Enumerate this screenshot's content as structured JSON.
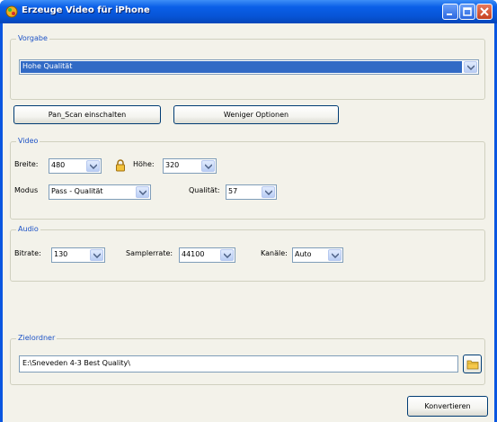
{
  "window": {
    "title": "Erzeuge Video für iPhone"
  },
  "vorgabe": {
    "legend": "Vorgabe",
    "selected": "Hohe Qualität"
  },
  "buttons": {
    "pan_scan": "Pan_Scan einschalten",
    "fewer_options": "Weniger Optionen",
    "convert": "Konvertieren"
  },
  "video": {
    "legend": "Video",
    "width_label": "Breite:",
    "width_value": "480",
    "height_label": "Höhe:",
    "height_value": "320",
    "mode_label": "Modus",
    "mode_value": "Pass - Qualität",
    "quality_label": "Qualität:",
    "quality_value": "57"
  },
  "audio": {
    "legend": "Audio",
    "bitrate_label": "Bitrate:",
    "bitrate_value": "130",
    "samplerate_label": "Samplerrate:",
    "samplerate_value": "44100",
    "channels_label": "Kanäle:",
    "channels_value": "Auto"
  },
  "target": {
    "legend": "Zielordner",
    "path": "E:\\Sneveden 4-3 Best Quality\\"
  },
  "icons": {
    "app": "media-app-icon",
    "lock": "lock-icon",
    "folder": "folder-icon",
    "dropdown": "chevron-down-icon"
  }
}
